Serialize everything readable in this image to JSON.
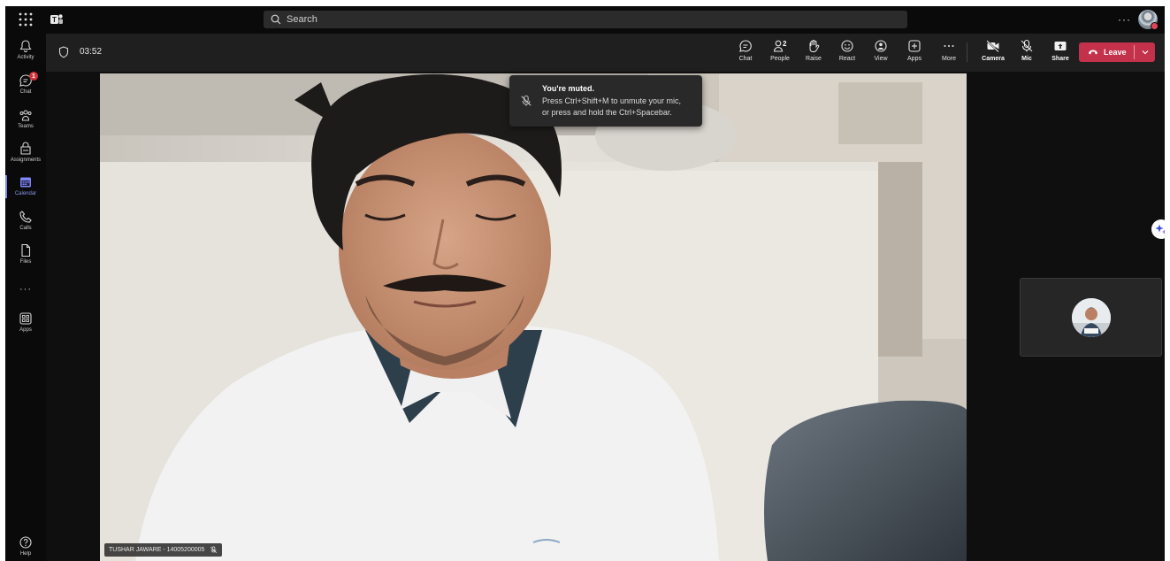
{
  "topbar": {
    "search_placeholder": "Search",
    "more_label": "···"
  },
  "rail": {
    "items": [
      {
        "label": "Activity",
        "icon": "bell-icon"
      },
      {
        "label": "Chat",
        "icon": "chat-icon",
        "badge": "1"
      },
      {
        "label": "Teams",
        "icon": "teams-icon"
      },
      {
        "label": "Assignments",
        "icon": "assignments-icon"
      },
      {
        "label": "Calendar",
        "icon": "calendar-icon",
        "active": true
      },
      {
        "label": "Calls",
        "icon": "phone-icon"
      },
      {
        "label": "Files",
        "icon": "file-icon"
      },
      {
        "label": "···",
        "icon": "more-icon"
      },
      {
        "label": "Apps",
        "icon": "apps-icon"
      },
      {
        "label": "Help",
        "icon": "help-icon"
      }
    ]
  },
  "meeting": {
    "timer": "03:52",
    "tools": [
      {
        "label": "Chat",
        "icon": "chat-icon"
      },
      {
        "label": "People",
        "icon": "people-icon",
        "count": "2"
      },
      {
        "label": "Raise",
        "icon": "hand-icon"
      },
      {
        "label": "React",
        "icon": "smiley-icon"
      },
      {
        "label": "View",
        "icon": "view-icon"
      },
      {
        "label": "Apps",
        "icon": "add-app-icon"
      },
      {
        "label": "More",
        "icon": "more-icon"
      },
      {
        "label": "Camera",
        "icon": "camera-off-icon"
      },
      {
        "label": "Mic",
        "icon": "mic-off-icon"
      },
      {
        "label": "Share",
        "icon": "share-icon"
      }
    ],
    "leave_label": "Leave",
    "leave_color": "#c4314b"
  },
  "toast": {
    "title": "You're muted.",
    "line1": "Press Ctrl+Shift+M to unmute your mic,",
    "line2": "or press and hold the Ctrl+Spacebar."
  },
  "video": {
    "participant_name": "TUSHAR JAWARE - 14005200005"
  },
  "colors": {
    "accent": "#7f85f5",
    "background": "#0f0f0f",
    "toolbar": "#1f1f1f"
  }
}
